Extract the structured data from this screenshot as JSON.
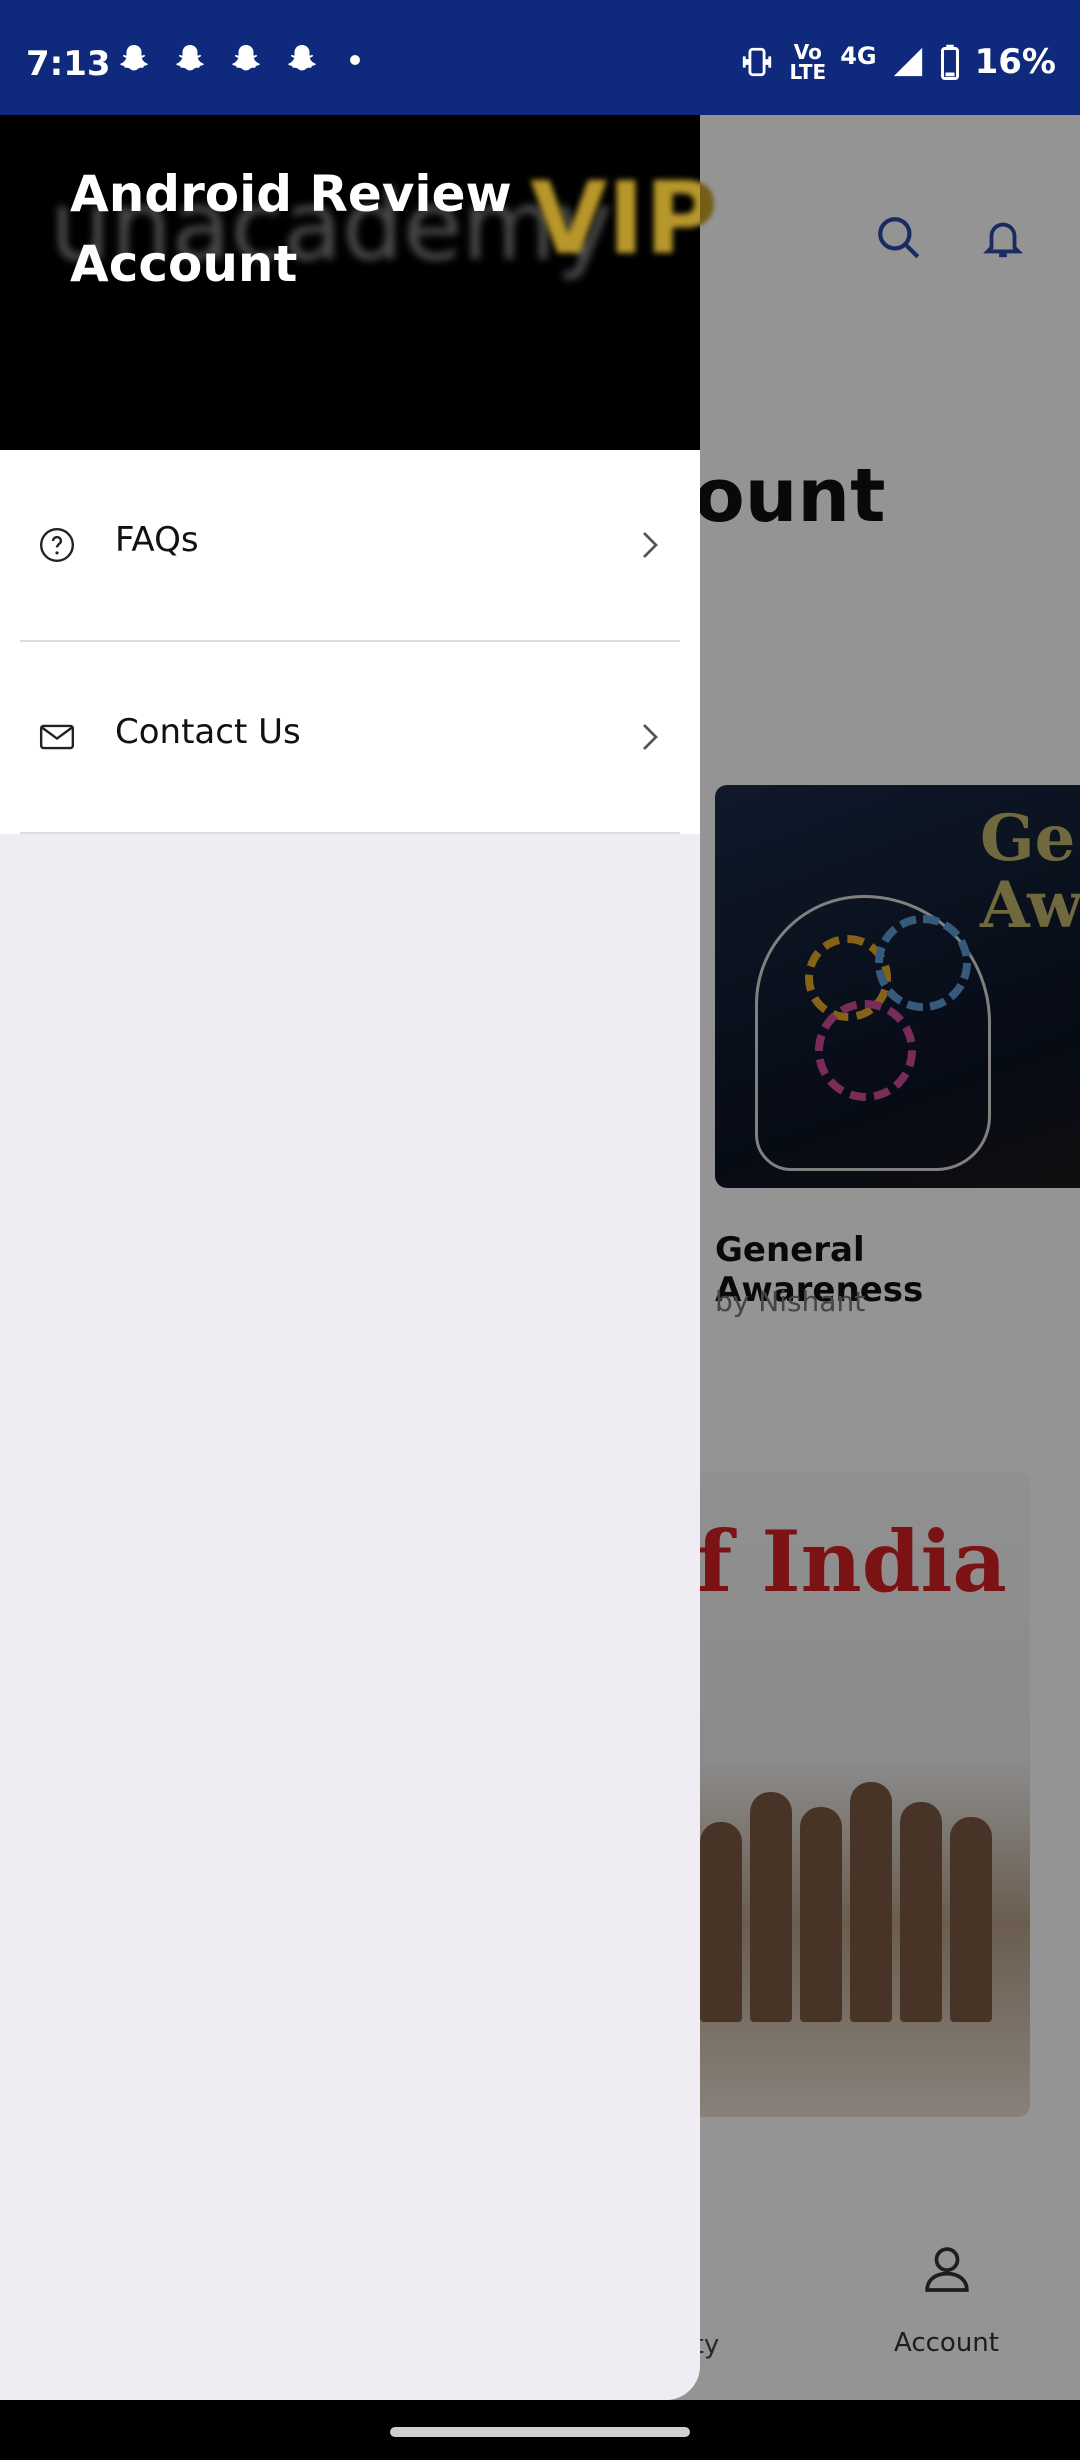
{
  "status_bar": {
    "time": "7:13",
    "notification_icons": [
      "snapchat-icon",
      "snapchat-icon",
      "snapchat-icon",
      "snapchat-icon",
      "more-dot-icon"
    ],
    "network_top": "Vo",
    "network_mid": "LTE",
    "network_type": "4G",
    "battery": "16%"
  },
  "background_app": {
    "logo_text": "unacademy",
    "logo_badge": "VIP",
    "page_title_fragment": "count",
    "course_1": {
      "image_text": "Ge\nAwa",
      "title": "General Awareness",
      "author": "by Nishant"
    },
    "course_2": {
      "image_text": "f India"
    },
    "bottom_nav": {
      "community_fragment": "nity",
      "account_label": "Account"
    }
  },
  "drawer": {
    "user_name": "Android Review Account",
    "menu": [
      {
        "label": "FAQs",
        "icon": "help-circle-icon"
      },
      {
        "label": "Contact Us",
        "icon": "mail-icon"
      }
    ]
  },
  "colors": {
    "status_bar": "#0f2a7d",
    "drawer_header": "#000000",
    "drawer_body": "#f0ecf3"
  }
}
